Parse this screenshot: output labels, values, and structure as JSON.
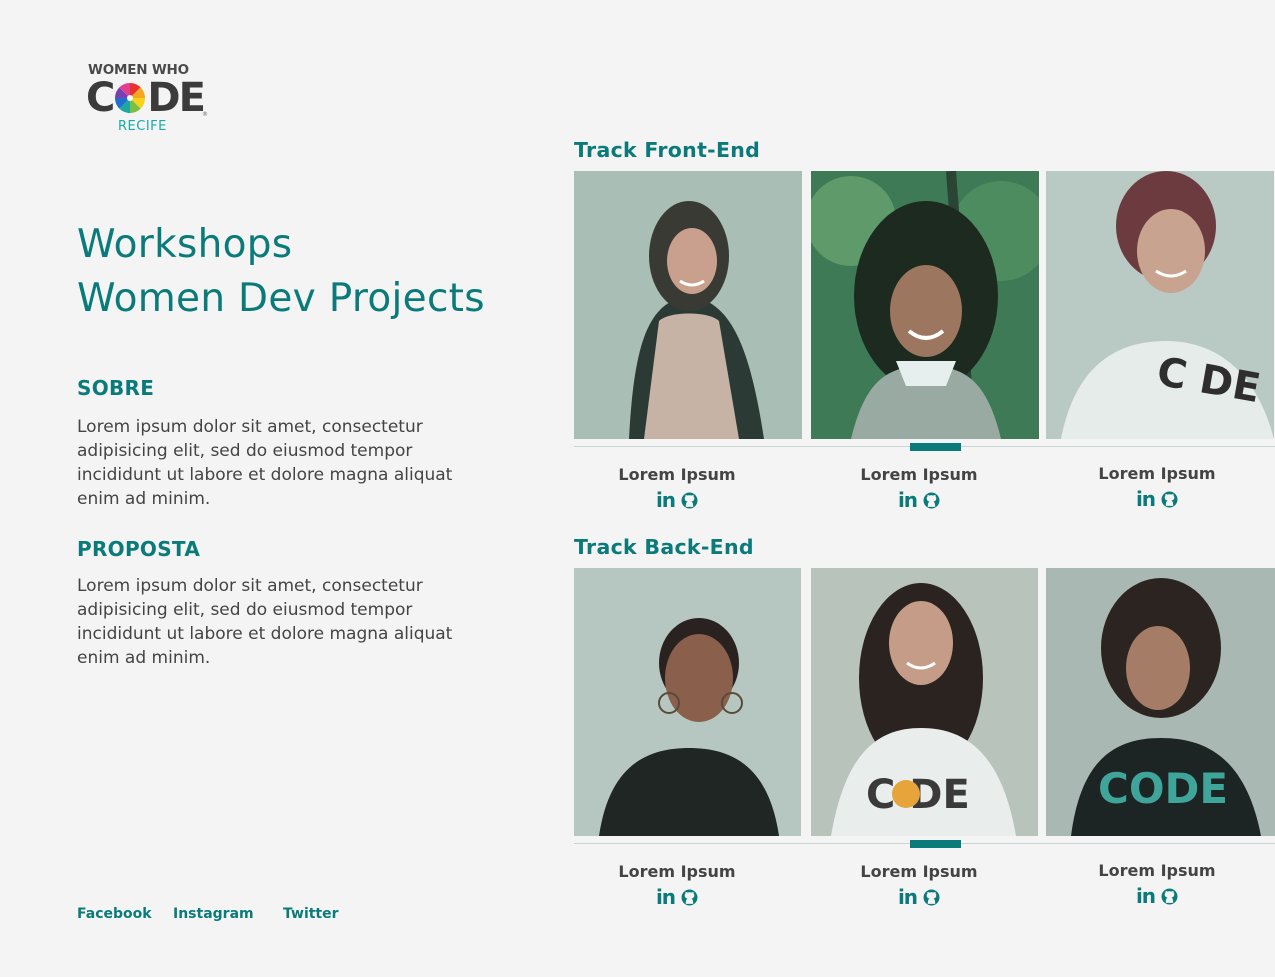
{
  "logo": {
    "top": "WOMEN WHO",
    "letters_left": "C",
    "letters_right": "DE",
    "city": "RECIFE",
    "reg": "®"
  },
  "headline": {
    "line1": "Workshops",
    "line2": "Women Dev Projects"
  },
  "sobre": {
    "title": "SOBRE",
    "body": "Lorem ipsum dolor sit amet, consectetur adipisicing elit, sed do eiusmod tempor incididunt ut labore et dolore magna aliquat enim ad minim."
  },
  "proposta": {
    "title": "PROPOSTA",
    "body": "Lorem ipsum dolor sit amet, consectetur adipisicing elit, sed do eiusmod tempor incididunt ut labore et dolore magna aliquat enim ad minim."
  },
  "tracks": [
    {
      "title": "Track Front-End",
      "members": [
        {
          "name": "Lorem Ipsum",
          "linkedin": "in"
        },
        {
          "name": "Lorem Ipsum",
          "linkedin": "in"
        },
        {
          "name": "Lorem Ipsum",
          "linkedin": "in"
        }
      ]
    },
    {
      "title": "Track Back-End",
      "members": [
        {
          "name": "Lorem Ipsum",
          "linkedin": "in"
        },
        {
          "name": "Lorem Ipsum",
          "linkedin": "in"
        },
        {
          "name": "Lorem Ipsum",
          "linkedin": "in"
        }
      ]
    }
  ],
  "footer": {
    "facebook": "Facebook",
    "instagram": "Instagram",
    "twitter": "Twitter"
  },
  "colors": {
    "accent": "#0b7a7a",
    "background": "#f4f4f4",
    "text": "#444444"
  },
  "icons": {
    "linkedin": "linkedin-icon",
    "github": "github-icon"
  }
}
